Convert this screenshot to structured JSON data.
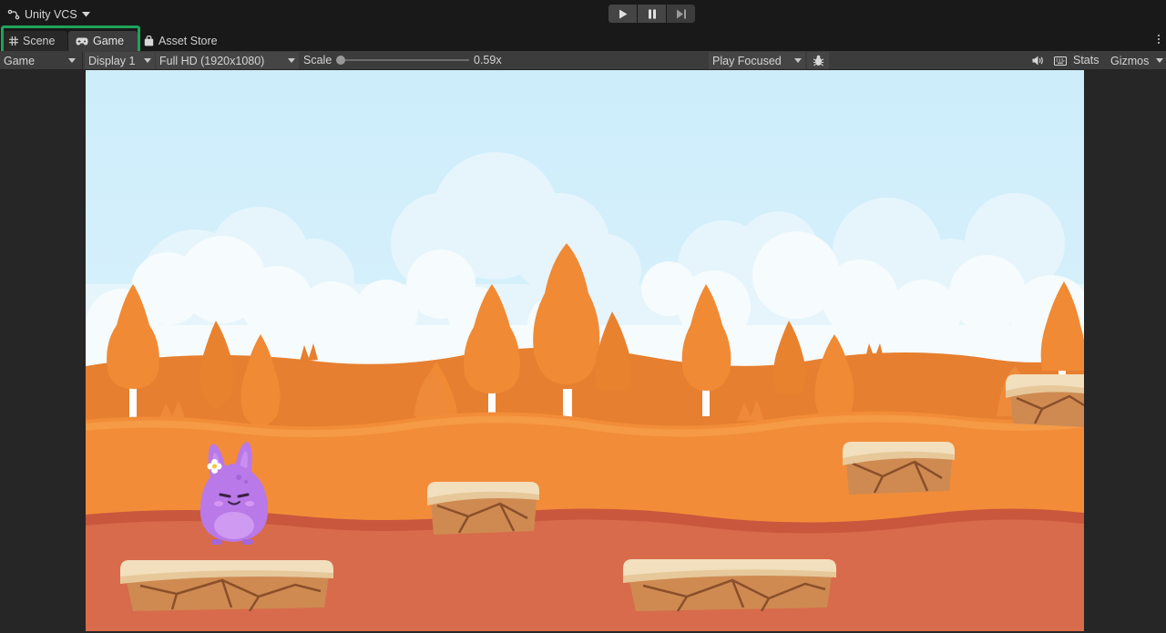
{
  "top_bar": {
    "vcs_label": "Unity VCS",
    "play_controls": [
      "play-icon",
      "pause-icon",
      "step-icon"
    ]
  },
  "tabs": [
    {
      "label": "Scene",
      "icon": "grid-icon",
      "active": false
    },
    {
      "label": "Game",
      "icon": "gamepad-icon",
      "active": true
    },
    {
      "label": "Asset Store",
      "icon": "shopping-bag-icon",
      "active": false
    }
  ],
  "view_toolbar": {
    "view_select": "Game",
    "display_select": "Display 1",
    "resolution_select": "Full HD (1920x1080)",
    "scale_label": "Scale",
    "scale_value": "0.59x",
    "scale_fraction": 0.0,
    "play_mode_select": "Play Focused",
    "stats_label": "Stats",
    "gizmos_label": "Gizmos"
  },
  "colors": {
    "highlight": "#1ea35a",
    "sky": "#cfeefc",
    "hills_far": "#e57f2e",
    "ground_mid": "#f28b36",
    "ground_near": "#d5684b",
    "character": "#b979e8"
  }
}
